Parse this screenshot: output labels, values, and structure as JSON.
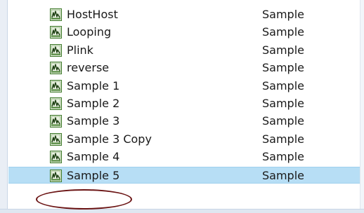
{
  "list": {
    "rows": [
      {
        "name": "HostHost",
        "type": "Sample",
        "icon": "audio-file-icon",
        "selected": false
      },
      {
        "name": "Looping",
        "type": "Sample",
        "icon": "audio-file-icon",
        "selected": false
      },
      {
        "name": "Plink",
        "type": "Sample",
        "icon": "audio-file-icon",
        "selected": false
      },
      {
        "name": "reverse",
        "type": "Sample",
        "icon": "audio-file-icon",
        "selected": false
      },
      {
        "name": "Sample 1",
        "type": "Sample",
        "icon": "audio-file-icon",
        "selected": false
      },
      {
        "name": "Sample 2",
        "type": "Sample",
        "icon": "audio-file-icon",
        "selected": false
      },
      {
        "name": "Sample 3",
        "type": "Sample",
        "icon": "audio-file-icon",
        "selected": false
      },
      {
        "name": "Sample 3 Copy",
        "type": "Sample",
        "icon": "audio-file-icon",
        "selected": false
      },
      {
        "name": "Sample 4",
        "type": "Sample",
        "icon": "audio-file-icon",
        "selected": false
      },
      {
        "name": "Sample 5",
        "type": "Sample",
        "icon": "audio-file-icon",
        "selected": true
      }
    ]
  },
  "colors": {
    "selection_bg": "#b7def5",
    "annotation_ellipse": "#6b1414",
    "icon_green": "#3f7a2a"
  }
}
